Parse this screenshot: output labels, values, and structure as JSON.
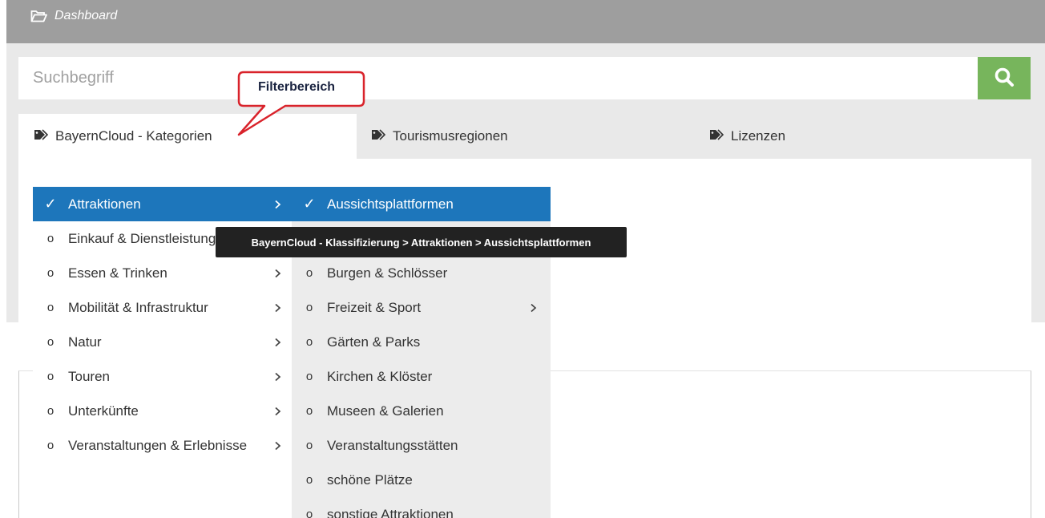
{
  "topbar": {
    "breadcrumb": "Dashboard",
    "icon": "folder-open-icon"
  },
  "search": {
    "placeholder": "Suchbegriff",
    "icon": "search-icon"
  },
  "tabs": [
    {
      "label": "BayernCloud - Kategorien",
      "icon": "tags-icon",
      "active": true
    },
    {
      "label": "Tourismusregionen",
      "icon": "tags-icon",
      "active": false
    },
    {
      "label": "Lizenzen",
      "icon": "tags-icon",
      "active": false
    }
  ],
  "menu_level1": [
    {
      "label": "Attraktionen",
      "marker": "✓",
      "selected": true,
      "submenu": true
    },
    {
      "label": "Einkauf & Dienstleistungen",
      "marker": "o",
      "selected": false,
      "submenu": true
    },
    {
      "label": "Essen & Trinken",
      "marker": "o",
      "selected": false,
      "submenu": true
    },
    {
      "label": "Mobilität & Infrastruktur",
      "marker": "o",
      "selected": false,
      "submenu": true
    },
    {
      "label": "Natur",
      "marker": "o",
      "selected": false,
      "submenu": true
    },
    {
      "label": "Touren",
      "marker": "o",
      "selected": false,
      "submenu": true
    },
    {
      "label": "Unterkünfte",
      "marker": "o",
      "selected": false,
      "submenu": true
    },
    {
      "label": "Veranstaltungen & Erlebnisse",
      "marker": "o",
      "selected": false,
      "submenu": true
    }
  ],
  "menu_level2": [
    {
      "label": "Aussichtsplattformen",
      "marker": "✓",
      "selected": true,
      "submenu": false
    },
    {
      "label": "",
      "marker": "o",
      "selected": false,
      "submenu": false
    },
    {
      "label": "Burgen & Schlösser",
      "marker": "o",
      "selected": false,
      "submenu": false
    },
    {
      "label": "Freizeit & Sport",
      "marker": "o",
      "selected": false,
      "submenu": true
    },
    {
      "label": "Gärten & Parks",
      "marker": "o",
      "selected": false,
      "submenu": false
    },
    {
      "label": "Kirchen & Klöster",
      "marker": "o",
      "selected": false,
      "submenu": false
    },
    {
      "label": "Museen & Galerien",
      "marker": "o",
      "selected": false,
      "submenu": false
    },
    {
      "label": "Veranstaltungsstätten",
      "marker": "o",
      "selected": false,
      "submenu": false
    },
    {
      "label": "schöne Plätze",
      "marker": "o",
      "selected": false,
      "submenu": false
    },
    {
      "label": "sonstige Attraktionen",
      "marker": "o",
      "selected": false,
      "submenu": false
    }
  ],
  "tooltip": "BayernCloud - Klassifizierung > Attraktionen > Aussichtsplattformen",
  "callout": {
    "text": "Filterbereich"
  },
  "colors": {
    "accent": "#1d76bb",
    "search_button": "#77b55c",
    "callout_border": "#d9232b",
    "topbar": "#9e9e9e"
  }
}
